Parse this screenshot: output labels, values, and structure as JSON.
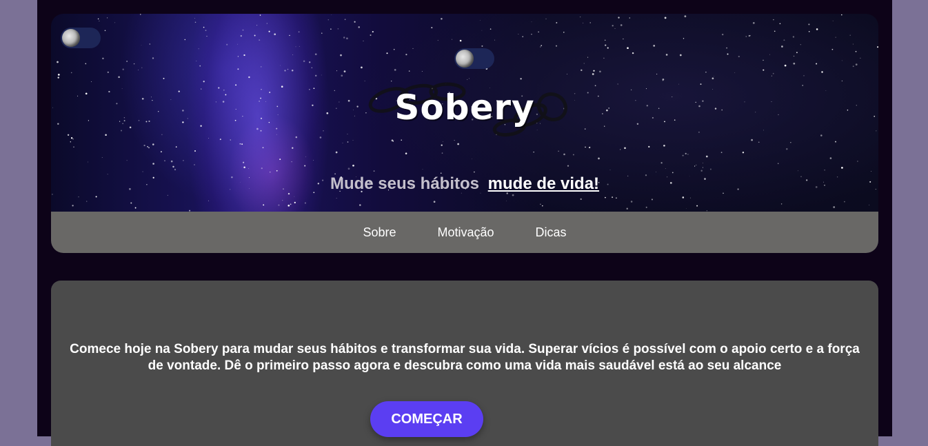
{
  "header": {
    "brand": "Sobery",
    "tagline_muted": "Mude seus hábitos",
    "tagline_strong": "mude de vida!"
  },
  "toggles": [
    {
      "icon": "moon-icon"
    },
    {
      "icon": "moon-icon"
    }
  ],
  "nav": {
    "items": [
      {
        "label": "Sobre"
      },
      {
        "label": "Motivação"
      },
      {
        "label": "Dicas"
      }
    ]
  },
  "main": {
    "intro": "Comece hoje na Sobery para mudar seus hábitos e transformar sua vida. Superar vícios é possível com o apoio certo e a força de vontade. Dê o primeiro passo agora e descubra como uma vida mais saudável está ao seu alcance",
    "cta_label": "COMEÇAR"
  },
  "colors": {
    "page_bg": "#7b7196",
    "content_bg": "#0d0318",
    "nav_bg": "#696866",
    "card_bg": "#4b4b4b",
    "cta_bg": "#5b3ef2"
  }
}
